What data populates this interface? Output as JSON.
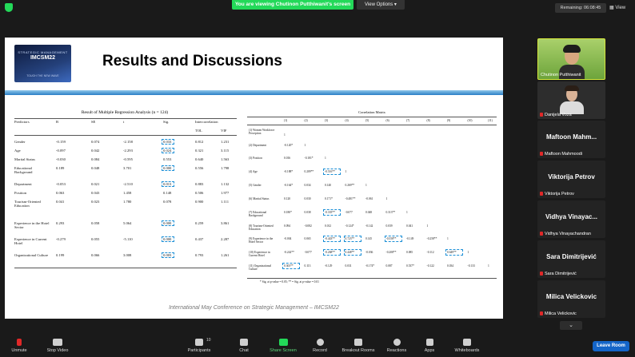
{
  "topbar": {
    "viewing_banner": "You are viewing Chutinon Putthiwanit's screen",
    "view_options": "View Options",
    "remaining": "Remaining: 06:08:45",
    "view_button": "View"
  },
  "slide": {
    "logo_line1": "STRATEGIC MANAGEMENT",
    "logo_line2": "IMCSM22",
    "logo_line3": "TOUGH THE NEW WAVE",
    "title": "Results and Discussions",
    "footer": "International May Conference on Strategic Management – IMCSM22"
  },
  "regression": {
    "title": "Result of Multiple Regression Analysis (n = 124)",
    "headers": [
      "Predictors",
      "B",
      "SE",
      "t",
      "Sig.",
      "Intercorrelation",
      "TOL",
      "VIF"
    ],
    "rows": [
      [
        "Gender",
        "-0.159",
        "0.074",
        "-2.158",
        "0.033",
        "0.812",
        "1.231"
      ],
      [
        "Age",
        "-0.097",
        "0.042",
        "-2.293",
        "0.024",
        "0.321",
        "3.115"
      ],
      [
        "Marital Status",
        "-0.030",
        "0.084",
        "-0.595",
        "0.553",
        "0.640",
        "1.563"
      ],
      [
        "Educational Background",
        "0.189",
        "0.048",
        "3.701",
        "0.000",
        "0.556",
        "1.798"
      ],
      [
        "Department",
        "-0.053",
        "0.021",
        "-2.510",
        "0.013",
        "0.883",
        "1.132"
      ],
      [
        "Position",
        "0.063",
        "0.043",
        "1.458",
        "0.148",
        "0.506",
        "1.977"
      ],
      [
        "Tourism-Oriented Education",
        "0.041",
        "0.023",
        "1.780",
        "0.078",
        "0.900",
        "1.111"
      ],
      [
        "Experience in the Hotel Sector",
        "0.293",
        "0.058",
        "5.064",
        "0.000",
        "0.259",
        "3.861"
      ],
      [
        "Experience in Current Hotel",
        "-0.279",
        "0.055",
        "-5.110",
        "0.000",
        "0.437",
        "2.287"
      ],
      [
        "Organizational Culture",
        "0.199",
        "0.066",
        "3.008",
        "0.003",
        "0.793",
        "1.261"
      ]
    ]
  },
  "correlation": {
    "title": "Correlation Matrix",
    "col_headers": [
      "(1)",
      "(2)",
      "(3)",
      "(4)",
      "(5)",
      "(6)",
      "(7)",
      "(8)",
      "(9)",
      "(10)",
      "(11)"
    ],
    "rows": [
      {
        "label": "(1) Women Workforce Perception",
        "vals": [
          "1"
        ]
      },
      {
        "label": "(2) Department",
        "vals": [
          "-0.120*",
          "1"
        ]
      },
      {
        "label": "(3) Position",
        "vals": [
          "0.016",
          "-0.181*",
          "1"
        ]
      },
      {
        "label": "(4) Age",
        "vals": [
          "-0.188*",
          "0.209**",
          "-0.516**",
          "1"
        ]
      },
      {
        "label": "(5) Gender",
        "vals": [
          "-0.164*",
          "0.034",
          "0.140",
          "0.269**",
          "1"
        ]
      },
      {
        "label": "(6) Marital Status",
        "vals": [
          "0.120",
          "0.030",
          "0.171*",
          "-0.481**",
          "-0.061",
          "1"
        ]
      },
      {
        "label": "(7) Educational Background",
        "vals": [
          "0.180*",
          "0.038",
          "-0.335**",
          "-0.077",
          "0.048",
          "0.313**",
          "1"
        ]
      },
      {
        "label": "(8) Tourism-Oriented Education",
        "vals": [
          "0.094",
          "-0.082",
          "0.012",
          "-0.124*",
          "-0.142",
          "0.039",
          "0.041",
          "1"
        ]
      },
      {
        "label": "(9) Experience in the Hotel Sector",
        "vals": [
          "-0.004",
          "0.065",
          "-0.443**",
          "0.723**",
          "0.145",
          "-0.558**",
          "-0.149",
          "-0.258**",
          "1"
        ]
      },
      {
        "label": "(10) Experience in Current Hotel",
        "vals": [
          "-0.242**",
          "-0.077",
          "-0.268**",
          "0.448**",
          "-0.036",
          "-0.208**",
          "0.085",
          "-0.112",
          "0.649**",
          "1"
        ]
      },
      {
        "label": "(11) Organizational Culture",
        "vals": [
          "0.303**",
          "0.113",
          "-0.129",
          "0.031",
          "-0.174*",
          "0.087",
          "0.537*",
          "-0.122",
          "0.034",
          "-0.133",
          "1"
        ]
      }
    ],
    "note": "* Sig. at p-value = 0.05; ** = Sig. at p-value = 0.01"
  },
  "participants": [
    {
      "name": "Chutinon Putthiwanit",
      "big_name": "",
      "mic": "on"
    },
    {
      "name": "Danijela Voza",
      "big_name": "",
      "mic": "muted"
    },
    {
      "name": "Maftoon Mahmoodi",
      "big_name": "Maftoon  Mahm...",
      "mic": "muted"
    },
    {
      "name": "Viktorija Petrov",
      "big_name": "Viktorija Petrov",
      "mic": "muted"
    },
    {
      "name": "Vidhya Vinayachandran",
      "big_name": "Vidhya  Vinayac...",
      "mic": "muted"
    },
    {
      "name": "Sara Dimitrijević",
      "big_name": "Sara Dimitrijević",
      "mic": "muted"
    },
    {
      "name": "Milica Velickovic",
      "big_name": "Milica Velickovic",
      "mic": "muted"
    }
  ],
  "toolbar": {
    "unmute": "Unmute",
    "stop_video": "Stop Video",
    "participants": "Participants",
    "participants_count": "10",
    "chat": "Chat",
    "share_screen": "Share Screen",
    "record": "Record",
    "breakout_rooms": "Breakout Rooms",
    "reactions": "Reactions",
    "apps": "Apps",
    "whiteboards": "Whiteboards",
    "leave_room": "Leave Room"
  },
  "colors": {
    "accent_green": "#23d959",
    "leave_blue": "#1465c8",
    "highlight_box": "#1c8fd6"
  }
}
